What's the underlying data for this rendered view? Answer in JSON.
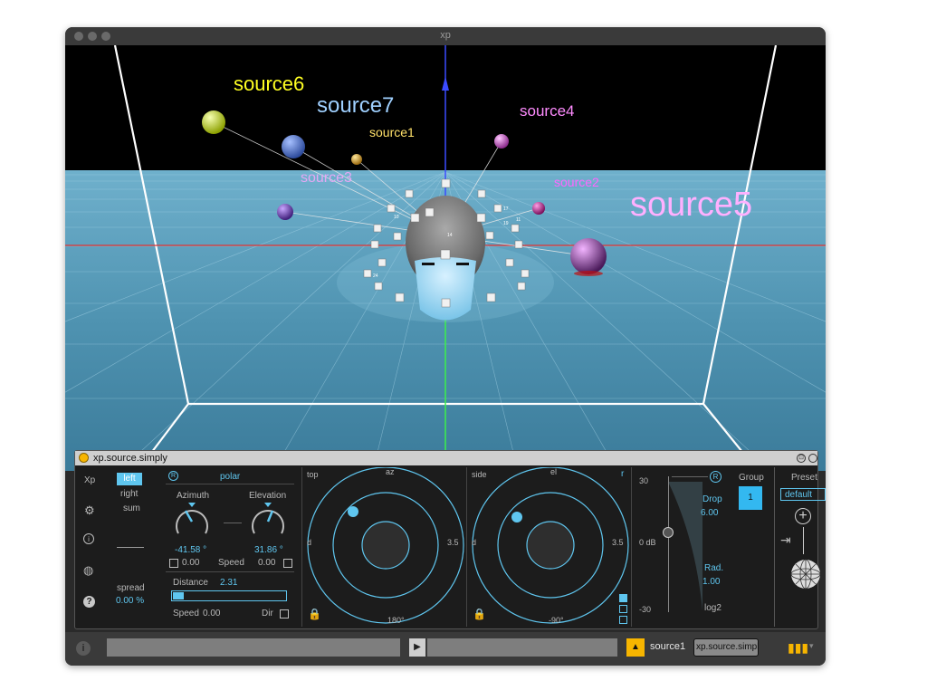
{
  "window": {
    "title": "xp"
  },
  "scene": {
    "sources": [
      {
        "name": "source6",
        "color": "#ffff22"
      },
      {
        "name": "source7",
        "color": "#9fd0ff"
      },
      {
        "name": "source1",
        "color": "#ffe16a"
      },
      {
        "name": "source4",
        "color": "#ff8cff"
      },
      {
        "name": "source3",
        "color": "#e4a8f4"
      },
      {
        "name": "source2",
        "color": "#ff66ff"
      },
      {
        "name": "source5",
        "color": "#ffb0ff"
      }
    ],
    "speaker_numbers": [
      "14",
      "24",
      "17",
      "19",
      "10",
      "11"
    ]
  },
  "device": {
    "title": "xp.source.simply",
    "left_menu": {
      "title": "Xp",
      "modes": [
        "left",
        "right",
        "sum"
      ],
      "active_mode": "left",
      "spread_label": "spread",
      "spread_value": "0.00 %"
    },
    "polar": {
      "r_button": "R",
      "label": "polar"
    },
    "azimuth": {
      "label": "Azimuth",
      "value": "-41.58 °",
      "speed_value": "0.00"
    },
    "elevation": {
      "label": "Elevation",
      "value": "31.86 °",
      "speed_value": "0.00"
    },
    "speed_label": "Speed",
    "distance": {
      "label": "Distance",
      "value": "2.31",
      "fill": 0.1,
      "speed_label": "Speed",
      "speed_value": "0.00",
      "dir_label": "Dir"
    },
    "top_view": {
      "label": "top",
      "axis_top": "az",
      "axis_left": "d",
      "axis_right": "3.5",
      "axis_bottom": "180°"
    },
    "side_view": {
      "label": "side",
      "axis_top": "el",
      "corner": "r",
      "axis_left": "d",
      "axis_right": "3.5",
      "axis_bottom": "-90°"
    },
    "gain": {
      "top": "30",
      "mid": "0 dB",
      "bottom": "-30",
      "scale": "log2",
      "r_button": "R"
    },
    "drop": {
      "label": "Drop",
      "value": "6.00"
    },
    "rad": {
      "label": "Rad.",
      "value": "1.00"
    },
    "group": {
      "label": "Group",
      "value": "1"
    },
    "preset": {
      "label": "Preset",
      "value": "default"
    },
    "colors": {
      "accent": "#5fc6ef",
      "group_bg": "#33b8f0",
      "panel_bg": "#1c1c1c",
      "orange": "#f7b500"
    }
  },
  "bottombar": {
    "source_name": "source1",
    "device_name": "xp.source.simply"
  }
}
